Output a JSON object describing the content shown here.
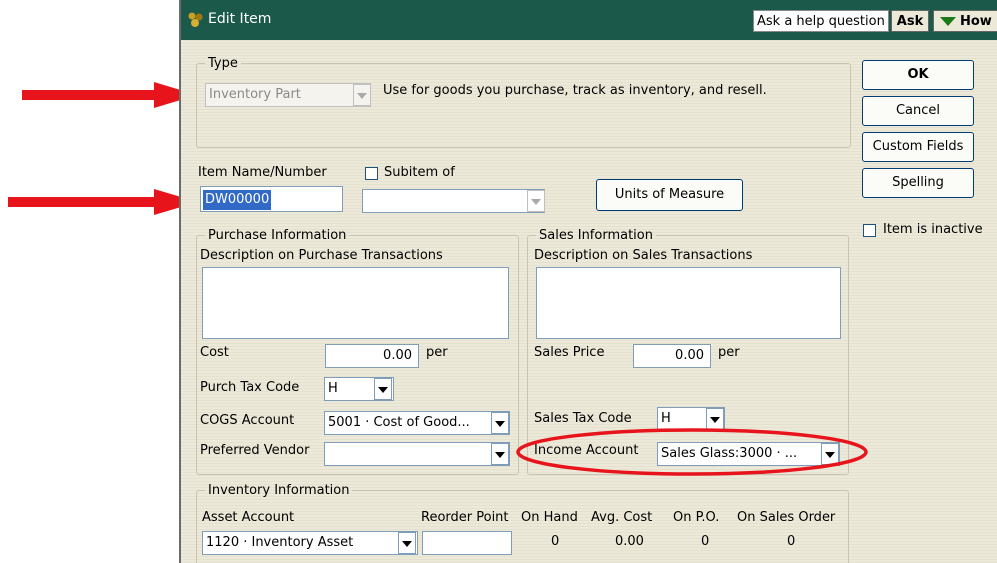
{
  "window": {
    "title": "Edit Item",
    "help_placeholder": "Ask a help question",
    "ask_label": "Ask",
    "how_label": "How"
  },
  "type_group": {
    "legend": "Type",
    "selected": "Inventory Part",
    "description": "Use for goods you purchase, track as inventory, and resell."
  },
  "item": {
    "name_label": "Item Name/Number",
    "name_value": "DW00000",
    "subitem_label": "Subitem of",
    "subitem_value": "",
    "units_button": "Units of Measure"
  },
  "purchase": {
    "legend": "Purchase Information",
    "desc_label": "Description on Purchase Transactions",
    "cost_label": "Cost",
    "cost_value": "0.00",
    "per_label": "per",
    "tax_label": "Purch Tax Code",
    "tax_value": "H",
    "cogs_label": "COGS Account",
    "cogs_value": "5001 · Cost of Good...",
    "vendor_label": "Preferred Vendor",
    "vendor_value": ""
  },
  "sales": {
    "legend": "Sales Information",
    "desc_label": "Description on Sales Transactions",
    "price_label": "Sales Price",
    "price_value": "0.00",
    "per_label": "per",
    "tax_label": "Sales Tax Code",
    "tax_value": "H",
    "income_label": "Income Account",
    "income_value": "Sales Glass:3000 · ..."
  },
  "inventory": {
    "legend": "Inventory Information",
    "asset_label": "Asset Account",
    "asset_value": "1120 · Inventory Asset",
    "reorder_label": "Reorder Point",
    "reorder_value": "",
    "on_hand_label": "On Hand",
    "on_hand_value": "0",
    "avg_cost_label": "Avg. Cost",
    "avg_cost_value": "0.00",
    "on_po_label": "On P.O.",
    "on_po_value": "0",
    "on_so_label": "On Sales Order",
    "on_so_value": "0"
  },
  "side_buttons": {
    "ok": "OK",
    "cancel": "Cancel",
    "custom_fields": "Custom Fields",
    "spelling": "Spelling",
    "inactive_label": "Item is inactive"
  },
  "colors": {
    "titlebar": "#1b5a4a",
    "arrow": "#e8141b",
    "highlight": "#3169c6"
  }
}
